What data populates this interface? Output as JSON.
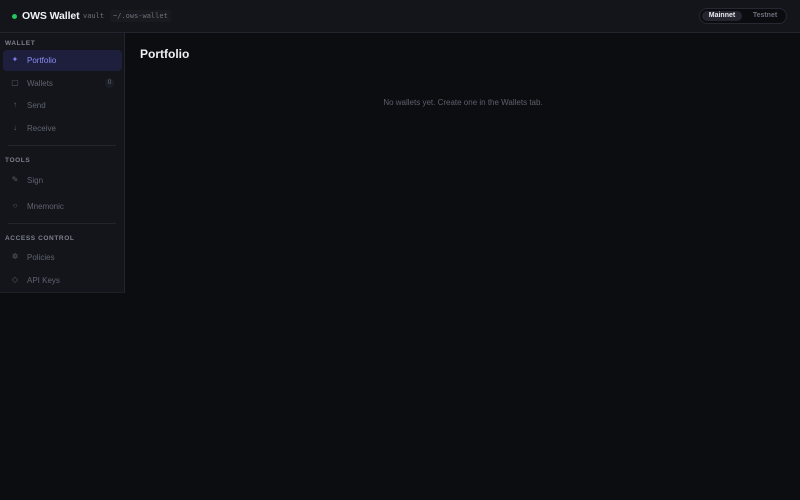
{
  "app": {
    "title": "OWS Wallet",
    "vault_label": "vault",
    "vault_path": "~/.ows-wallet",
    "brand_color": "#22c55e"
  },
  "network": {
    "options": [
      "Mainnet",
      "Testnet"
    ],
    "selected": "Mainnet"
  },
  "sidebar": {
    "sections": [
      {
        "title": "WALLET",
        "items": [
          {
            "label": "Portfolio",
            "icon": "sparkle-icon",
            "glyph": "✦",
            "active": true
          },
          {
            "label": "Wallets",
            "icon": "wallet-icon",
            "glyph": "▢",
            "badge": "0"
          },
          {
            "label": "Send",
            "icon": "arrow-up-icon",
            "glyph": "↑"
          },
          {
            "label": "Receive",
            "icon": "arrow-down-icon",
            "glyph": "↓"
          }
        ]
      },
      {
        "title": "TOOLS",
        "items": [
          {
            "label": "Sign",
            "icon": "signature-icon",
            "glyph": "✎"
          },
          {
            "label": "Mnemonic",
            "icon": "key-ring-icon",
            "glyph": "○"
          }
        ]
      },
      {
        "title": "ACCESS CONTROL",
        "items": [
          {
            "label": "Policies",
            "icon": "policy-icon",
            "glyph": "✲"
          },
          {
            "label": "API Keys",
            "icon": "api-key-icon",
            "glyph": "◇"
          }
        ]
      }
    ]
  },
  "main": {
    "title": "Portfolio",
    "empty_message": "No wallets yet. Create one in the Wallets tab."
  },
  "colors": {
    "accent": "#7c7ff0",
    "background": "#0c0d11",
    "panel": "#13151b"
  }
}
